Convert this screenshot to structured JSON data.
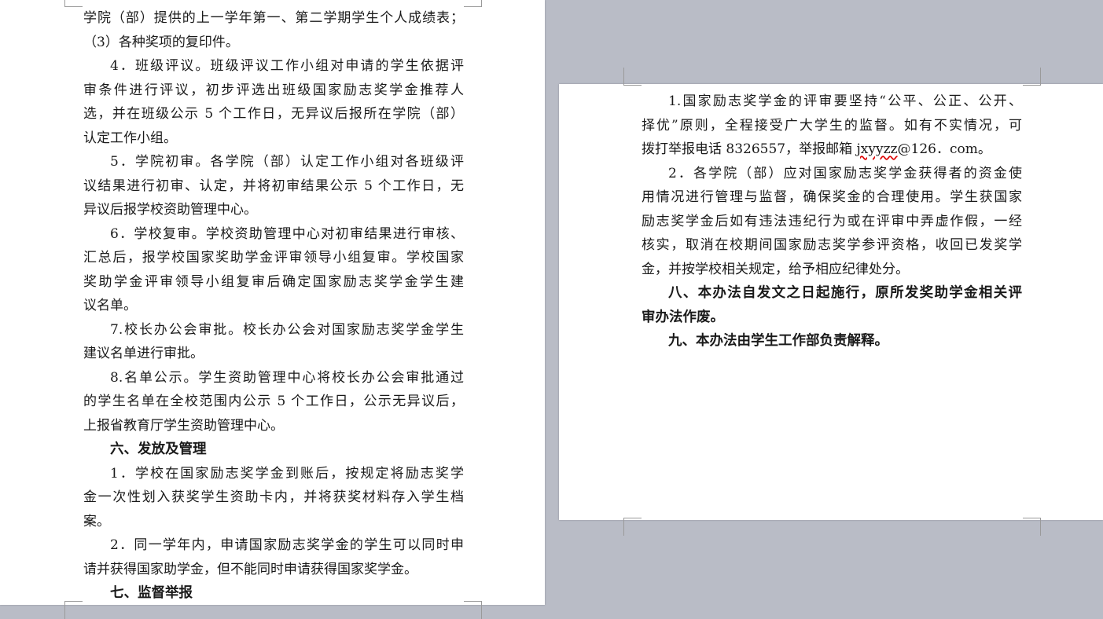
{
  "page_left": {
    "lines": [
      "学院（部）提供的上一学年第一、第二学期学生个人成绩表；",
      "（3）各种奖项的复印件。",
      "4．班级评议。班级评议工作小组对申请的学生依据评",
      "审条件进行评议，初步评选出班级国家励志奖学金推荐人",
      "选，并在班级公示 5 个工作日，无异议后报所在学院（部）",
      "认定工作小组。",
      "5．学院初审。各学院（部）认定工作小组对各班级评",
      "议结果进行初审、认定，并将初审结果公示 5 个工作日，无",
      "异议后报学校资助管理中心。",
      "6．学校复审。学校资助管理中心对初审结果进行审核、",
      "汇总后，报学校国家奖助学金评审领导小组复审。学校国家",
      "奖助学金评审领导小组复审后确定国家励志奖学金学生建",
      "议名单。",
      "7.校长办公会审批。校长办公会对国家励志奖学金学生",
      "建议名单进行审批。",
      "8.名单公示。学生资助管理中心将校长办公会审批通过",
      "的学生名单在全校范围内公示 5 个工作日，公示无异议后，",
      "上报省教育厅学生资助管理中心。",
      "六、发放及管理",
      "1．学校在国家励志奖学金到账后，按规定将励志奖学",
      "金一次性划入获奖学生资助卡内，并将获奖材料存入学生档",
      "案。",
      "2．同一学年内，申请国家励志奖学金的学生可以同时申",
      "请并获得国家助学金，但不能同时申请获得国家奖学金。",
      "七、监督举报"
    ]
  },
  "page_right": {
    "lines": [
      "1.国家励志奖学金的评审要坚持“公平、公正、公开、",
      "择优”原则，全程接受广大学生的监督。如有不实情况，可",
      "拨打举报电话 8326557，举报邮箱 ",
      "2．各学院（部）应对国家励志奖学金获得者的资金使",
      "用情况进行管理与监督，确保奖金的合理使用。学生获国家",
      "励志奖学金后如有违法违纪行为或在评审中弄虚作假，一经",
      "核实，取消在校期间国家励志奖学参评资格，收回已发奖学",
      "金，并按学校相关规定，给予相应纪律处分。",
      "八、本办法自发文之日起施行，原所发奖助学金相关评",
      "审办法作废。",
      "九、本办法由学生工作部负责解释。"
    ],
    "email_user": "jxyyzz",
    "email_domain": "@126．com。"
  }
}
